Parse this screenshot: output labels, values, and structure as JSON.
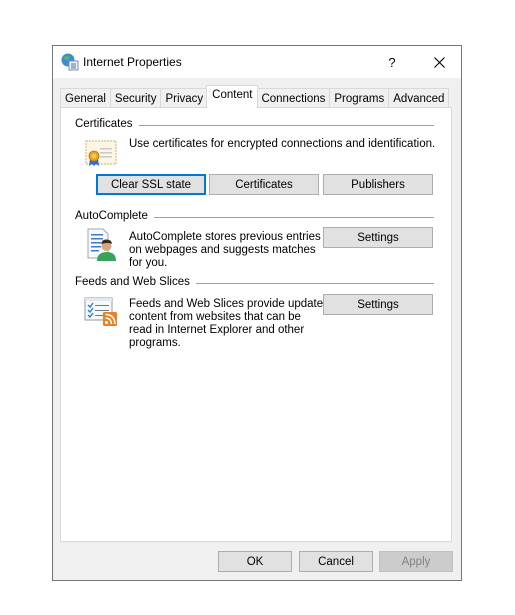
{
  "window": {
    "title": "Internet Properties",
    "help_label": "?",
    "close_icon": "close-icon",
    "title_icon": "internet-options-icon"
  },
  "tabs": [
    {
      "label": "General",
      "active": false
    },
    {
      "label": "Security",
      "active": false
    },
    {
      "label": "Privacy",
      "active": false
    },
    {
      "label": "Content",
      "active": true
    },
    {
      "label": "Connections",
      "active": false
    },
    {
      "label": "Programs",
      "active": false
    },
    {
      "label": "Advanced",
      "active": false
    }
  ],
  "certificates": {
    "group_label": "Certificates",
    "icon": "certificate-icon",
    "description": "Use certificates for encrypted connections and identification.",
    "buttons": {
      "clear_ssl": "Clear SSL state",
      "certificates": "Certificates",
      "publishers": "Publishers"
    }
  },
  "autocomplete": {
    "group_label": "AutoComplete",
    "icon": "autocomplete-icon",
    "description_lines": [
      "AutoComplete stores previous entries",
      "on webpages and suggests matches",
      "for you."
    ],
    "settings_label": "Settings"
  },
  "feeds": {
    "group_label": "Feeds and Web Slices",
    "icon": "feeds-icon",
    "description_lines": [
      "Feeds and Web Slices provide updated",
      "content from websites that can be",
      "read in Internet Explorer and other",
      "programs."
    ],
    "settings_label": "Settings"
  },
  "footer": {
    "ok_label": "OK",
    "cancel_label": "Cancel",
    "apply_label": "Apply",
    "apply_enabled": false
  }
}
